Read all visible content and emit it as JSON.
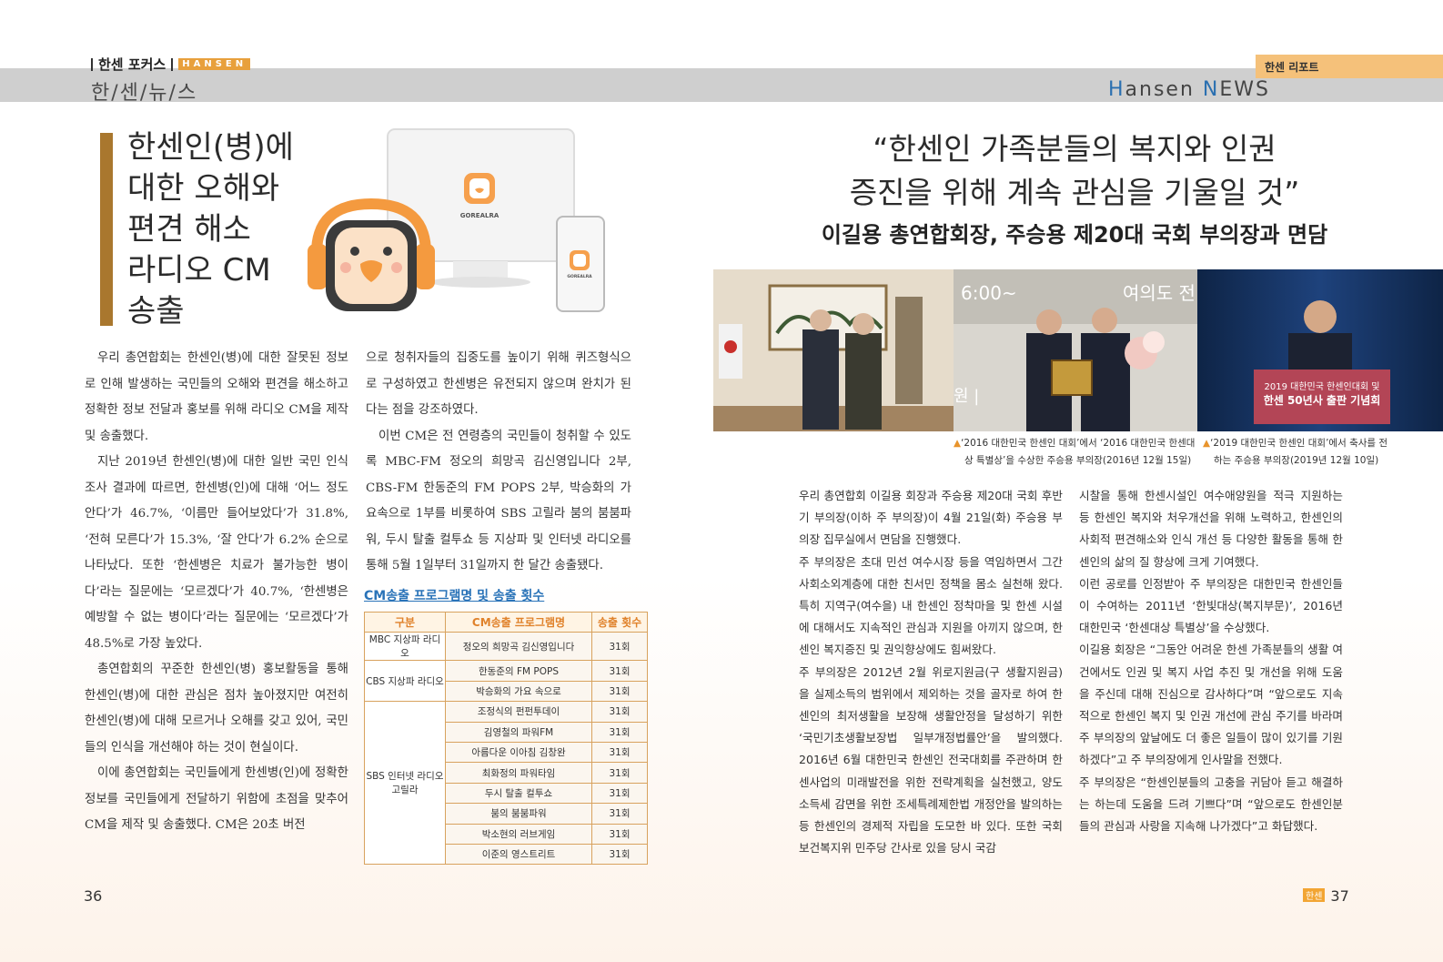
{
  "left_header": {
    "section": "한센 포커스",
    "tag": "HANSEN",
    "sub": "한/센/뉴/스"
  },
  "right_header": {
    "report": "한센 리포트",
    "news_h": "H",
    "news_ansen": "ansen ",
    "news_n": "N",
    "news_ews": "EWS"
  },
  "left_article": {
    "title": [
      "한센인(병)에",
      "대한 오해와",
      "편견 해소",
      "라디오 CM",
      "송출"
    ],
    "logo_text": "GOREALRA",
    "col1": [
      "우리 총연합회는 한센인(병)에 대한 잘못된 정보로 인해 발생하는 국민들의 오해와 편견을 해소하고 정확한 정보 전달과 홍보를 위해 라디오 CM을 제작 및 송출했다.",
      "지난 2019년 한센인(병)에 대한 일반 국민 인식 조사 결과에 따르면, 한센병(인)에 대해 ‘어느 정도 안다’가 46.7%, ‘이름만 들어보았다’가 31.8%, ‘전혀 모른다’가 15.3%, ‘잘 안다’가 6.2% 순으로 나타났다. 또한 ‘한센병은 치료가 불가능한 병이다’라는 질문에는 ‘모르겠다’가 40.7%, ‘한센병은 예방할 수 없는 병이다’라는 질문에는 ‘모르겠다’가 48.5%로 가장 높았다.",
      "총연합회의 꾸준한 한센인(병) 홍보활동을 통해 한센인(병)에 대한 관심은 점차 높아졌지만 여전히 한센인(병)에 대해 모르거나 오해를 갖고 있어, 국민들의 인식을 개선해야 하는 것이 현실이다.",
      "이에 총연합회는 국민들에게 한센병(인)에 정확한 정보를 국민들에게 전달하기 위함에 초점을 맞추어 CM을 제작 및 송출했다. CM은 20초 버전"
    ],
    "col2": [
      "으로 청취자들의 집중도를 높이기 위해 퀴즈형식으로 구성하였고 한센병은 유전되지 않으며 완치가 된다는 점을 강조하였다.",
      "이번 CM은 전 연령층의 국민들이 청취할 수 있도록 MBC-FM 정오의 희망곡 김신영입니다 2부, CBS-FM 한동준의 FM POPS 2부, 박승화의 가요속으로 1부를 비롯하여 SBS 고릴라 붐의 붐붐파워, 두시 탈출 컬투쇼 등 지상파 및 인터넷 라디오를 통해 5월 1일부터 31일까지 한 달간 송출됐다."
    ],
    "table_title": "CM송출 프로그램명 및 송출 횟수",
    "table_headers": [
      "구분",
      "CM송출 프로그램명",
      "송출 횟수"
    ],
    "groups": [
      "MBC 지상파 라디오",
      "CBS 지상파 라디오",
      "SBS 인터넷 라디오 고릴라"
    ],
    "programs": [
      "정오의 희망곡 김신영입니다",
      "한동준의 FM POPS",
      "박승화의 가요 속으로",
      "조정식의 펀펀투데이",
      "김영철의 파워FM",
      "아름다운 이아침 김창완",
      "최화정의 파워타임",
      "두시 탈출 컬투쇼",
      "붐의 붐붐파워",
      "박소현의 러브게임",
      "이준의 영스트리트"
    ],
    "count": "31회",
    "page": "36"
  },
  "right_article": {
    "title1": "“한센인 가족분들의 복지와 인권",
    "title2": "증진을 위해 계속 관심을 기울일 것”",
    "subtitle": "이길용 총연합회장, 주승용 제20대 국회 부의장과 면담",
    "photo2_text1": "6:00~",
    "photo2_text2": "여의도 전",
    "photo2_text3": "원 |",
    "photo3_banner1": "2019 대한민국 한센인대회 및",
    "photo3_banner2": "한센 50년사 출판 기념회",
    "caption1a": "‘2016 대한민국 한센인 대회’에서 ‘2016 대한민국 한센대",
    "caption1b": "상 특별상’을 수상한 주승용 부의장(2016년 12월 15일)",
    "caption2a": "‘2019 대한민국 한센인 대회’에서 축사를 전",
    "caption2b": "하는 주승용 부의장(2019년 12월 10일)",
    "col1": [
      "우리 총연합회 이길용 회장과 주승용 제20대 국회 후반기 부의장(이하 주 부의장)이 4월 21일(화) 주승용 부의장 집무실에서 면담을 진행했다.",
      "주 부의장은 초대 민선 여수시장 등을 역임하면서 그간 사회소외계층에 대한 친서민 정책을 몸소 실천해 왔다. 특히 지역구(여수을) 내 한센인 정착마을 및 한센 시설에 대해서도 지속적인 관심과 지원을 아끼지 않으며, 한센인 복지증진 및 권익향상에도 힘써왔다.",
      "주 부의장은 2012년 2월 위로지원금(구 생활지원금)을 실제소득의 범위에서 제외하는 것을 골자로 하여 한센인의 최저생활을 보장해 생활안정을 달성하기 위한 ‘국민기초생활보장법 일부개정법률안’을 발의했다. 2016년 6월 대한민국 한센인 전국대회를 주관하며 한센사업의 미래발전을 위한 전략계획을 실천했고, 양도소득세 감면을 위한 조세특례제한법 개정안을 발의하는 등 한센인의 경제적 자립을 도모한 바 있다. 또한 국회 보건복지위 민주당 간사로 있을 당시 국감"
    ],
    "col2": [
      "시찰을 통해 한센시설인 여수애양원을 적극 지원하는 등 한센인 복지와 처우개선을 위해 노력하고, 한센인의 사회적 편견해소와 인식 개선 등 다양한 활동을 통해 한센인의 삶의 질 향상에 크게 기여했다.",
      "이런 공로를 인정받아 주 부의장은 대한민국 한센인들이 수여하는 2011년 ‘한빛대상(복지부문)’, 2016년 대한민국 ‘한센대상 특별상’을 수상했다.",
      "이길용 회장은 “그동안 어려운 한센 가족분들의 생활 여건에서도 인권 및 복지 사업 추진 및 개선을 위해 도움을 주신데 대해 진심으로 감사하다”며 “앞으로도 지속적으로 한센인 복지 및 인권 개선에 관심 주기를 바라며 주 부의장의 앞날에도 더 좋은 일들이 많이 있기를 기원하겠다”고 주 부의장에게 인사말을 전했다.",
      "주 부의장은 “한센인분들의 고충을 귀담아 듣고 해결하는 하는데 도움을 드려 기쁘다”며 “앞으로도 한센인분들의 관심과 사랑을 지속해 나가겠다”고 화답했다."
    ],
    "logo_mini": "한센",
    "page": "37"
  }
}
